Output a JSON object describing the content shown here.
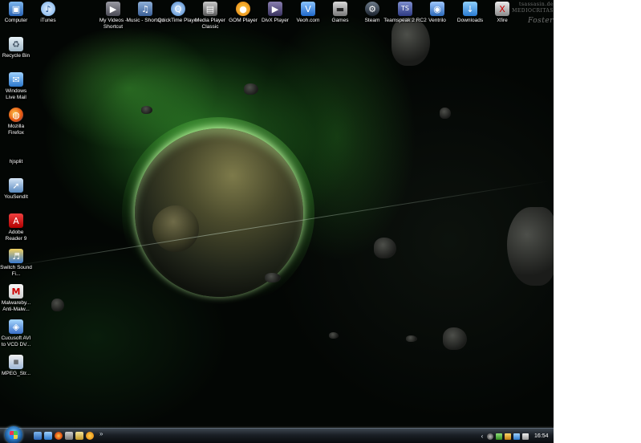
{
  "desktop": {
    "top_icons": [
      {
        "label": "Computer",
        "icon": "computer-icon",
        "glyph": "▣"
      },
      {
        "label": "iTunes",
        "icon": "itunes-icon",
        "glyph": "♪"
      },
      {
        "label": "My Videos - Shortcut",
        "icon": "videos-shortcut-icon",
        "glyph": "▶"
      },
      {
        "label": "Music - Shortcut",
        "icon": "music-shortcut-icon",
        "glyph": "♫"
      },
      {
        "label": "QuickTime Player",
        "icon": "quicktime-icon",
        "glyph": "Q"
      },
      {
        "label": "Media Player Classic",
        "icon": "media-player-classic-icon",
        "glyph": "▤"
      },
      {
        "label": "GOM Player",
        "icon": "gom-player-icon",
        "glyph": "●"
      },
      {
        "label": "DivX Player",
        "icon": "divx-player-icon",
        "glyph": "▶"
      },
      {
        "label": "Veoh.com",
        "icon": "veoh-icon",
        "glyph": "V"
      },
      {
        "label": "Games",
        "icon": "games-icon",
        "glyph": "▬"
      },
      {
        "label": "Steam",
        "icon": "steam-icon",
        "glyph": "⚙"
      },
      {
        "label": "Teamspeak 2 RC2",
        "icon": "teamspeak-icon",
        "glyph": "TS"
      },
      {
        "label": "Ventrilo",
        "icon": "ventrilo-icon",
        "glyph": "◉"
      },
      {
        "label": "Downloads",
        "icon": "downloads-icon",
        "glyph": "↓"
      },
      {
        "label": "Xfire",
        "icon": "xfire-icon",
        "glyph": "X"
      }
    ],
    "left_icons": [
      {
        "label": "Recycle Bin",
        "icon": "recycle-bin-icon",
        "glyph": "♻"
      },
      {
        "label": "Windows Live Mail",
        "icon": "windows-live-mail-icon",
        "glyph": "✉"
      },
      {
        "label": "Mozilla Firefox",
        "icon": "firefox-icon",
        "glyph": "◍"
      },
      {
        "label": "hjsplit",
        "icon": "hjsplit-icon",
        "glyph": ""
      },
      {
        "label": "YouSendIt",
        "icon": "yousendit-icon",
        "glyph": "➚"
      },
      {
        "label": "Adobe Reader 9",
        "icon": "adobe-reader-icon",
        "glyph": "A"
      },
      {
        "label": "Switch Sound Fi...",
        "icon": "switch-sound-icon",
        "glyph": "♬"
      },
      {
        "label": "Malwareby... Anti-Malw...",
        "icon": "malwarebytes-icon",
        "glyph": "M"
      },
      {
        "label": "Cucusoft AVI to VCD DV...",
        "icon": "cucusoft-icon",
        "glyph": "◈"
      },
      {
        "label": "MPEG_Str...",
        "icon": "mpeg-streamclip-icon",
        "glyph": "▦"
      }
    ],
    "watermark": {
      "line1": "tsassasin.de",
      "line2": "MEDIOCRITAS",
      "signature": "Foster"
    }
  },
  "taskbar": {
    "start": "start-button",
    "quicklaunch_more": "»",
    "tray_chevron": "‹",
    "clock": "16:54"
  },
  "colors": {
    "taskbar": "#1a1f25",
    "space": "#030604",
    "nebula_green": "#46c83c"
  }
}
